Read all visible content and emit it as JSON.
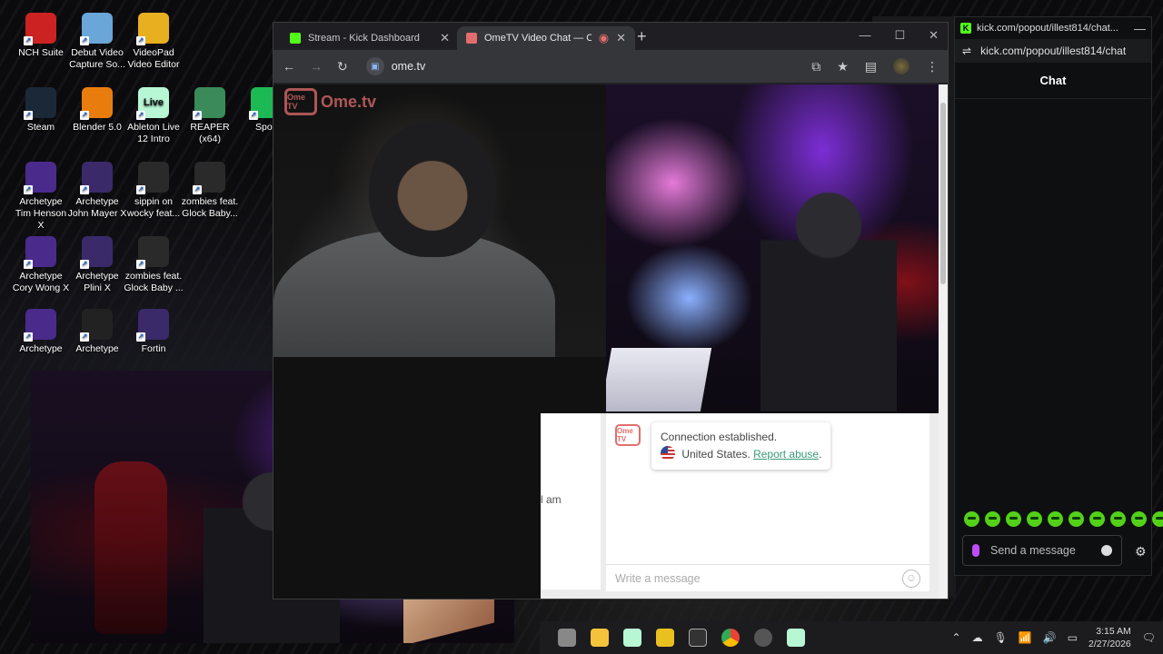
{
  "desktop": {
    "icons": [
      {
        "label": "NCH Suite",
        "color": "#c22"
      },
      {
        "label": "Debut Video Capture So...",
        "color": "#6aa6d8"
      },
      {
        "label": "VideoPad Video Editor",
        "color": "#e8b020"
      },
      {
        "label": "Steam",
        "color": "#1b2838"
      },
      {
        "label": "Blender 5.0",
        "color": "#e87d0d"
      },
      {
        "label": "Ableton Live 12 Intro",
        "color": "#b8f7d4",
        "glyph": "Live"
      },
      {
        "label": "REAPER (x64)",
        "color": "#3a8a5a"
      },
      {
        "label": "Spoti",
        "color": "#1db954"
      },
      {
        "label": "Archetype Tim Henson X",
        "color": "#4a2a8a"
      },
      {
        "label": "Archetype John Mayer X",
        "color": "#3a2a6a"
      },
      {
        "label": "sippin on wocky feat...",
        "color": "#2a2a2a"
      },
      {
        "label": "zombies feat. Glock Baby...",
        "color": "#2a2a2a"
      },
      {
        "label": "Archetype Cory Wong X",
        "color": "#4a2a8a"
      },
      {
        "label": "Archetype Plini X",
        "color": "#3a2a6a"
      },
      {
        "label": "zombies feat. Glock Baby ...",
        "color": "#2a2a2a"
      },
      {
        "label": "Archetype",
        "color": "#4a2a8a"
      },
      {
        "label": "Archetype",
        "color": "#222"
      },
      {
        "label": "Fortin",
        "color": "#3a2a6a"
      }
    ]
  },
  "browser": {
    "tabs": [
      {
        "title": "Stream - Kick Dashboard",
        "favicon_color": "#53fc18",
        "active": false
      },
      {
        "title": "OmeTV Video Chat — Ome",
        "favicon_color": "#e26d6d",
        "active": true
      }
    ],
    "new_tab": "+",
    "url": "ome.tv",
    "window_controls": [
      "—",
      "☐",
      "✕"
    ]
  },
  "ometv": {
    "logo_text": "Ome.tv",
    "logo_badge": "Ome TV",
    "left_snippet": "l am",
    "message_avatar": "Ome TV",
    "connection_text": "Connection established.",
    "country": "United States.",
    "report_link": "Report abuse",
    "write_placeholder": "Write a message"
  },
  "kick_popout": {
    "title": "kick.com/popout/illest814/chat...",
    "url": "kick.com/popout/illest814/chat",
    "chat_header": "Chat",
    "input_placeholder": "Send a message",
    "emote_count": 10
  },
  "taskbar": {
    "time": "3:15 AM",
    "date": "2/27/2026"
  }
}
